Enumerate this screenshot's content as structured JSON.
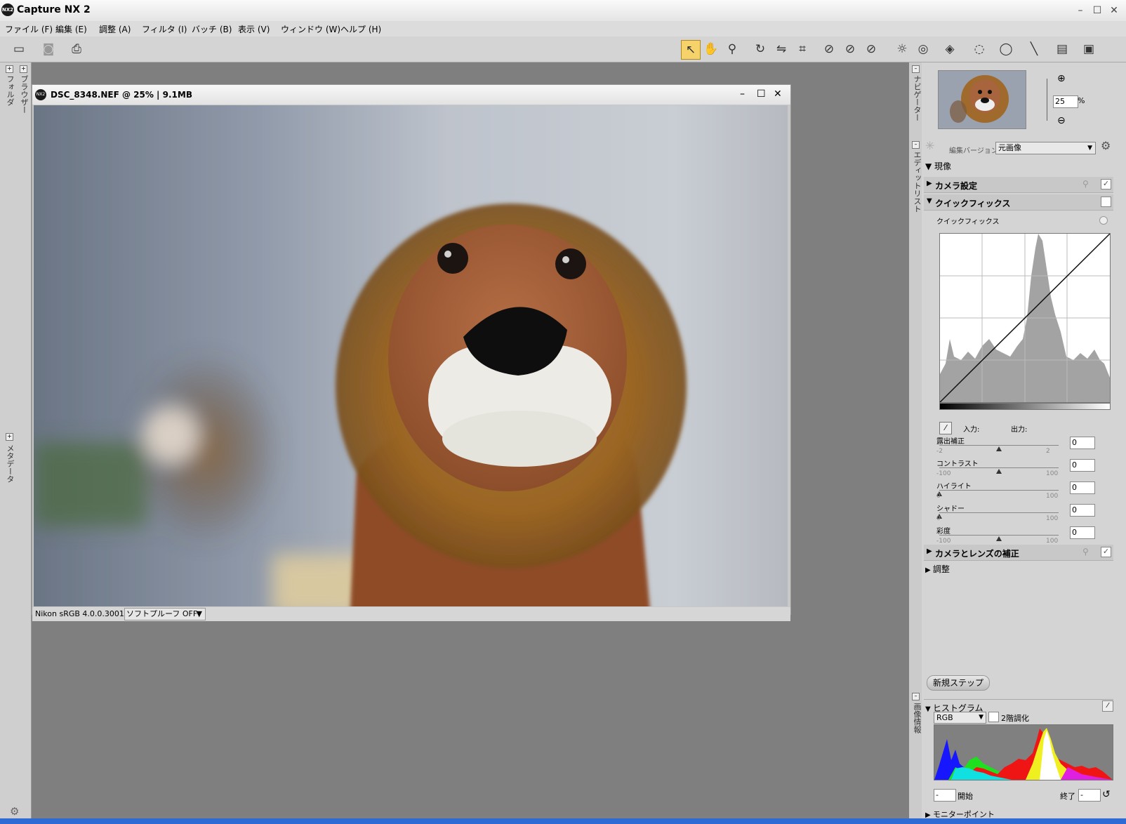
{
  "app": {
    "title": "Capture NX 2",
    "logo_text": "NX2",
    "window_buttons": [
      "–",
      "☐",
      "✕"
    ]
  },
  "menu": [
    "ファイル (F)",
    "編集 (E)",
    "調整 (A)",
    "フィルタ (I)",
    "バッチ (B)",
    "表示 (V)",
    "ウィンドウ (W)",
    "ヘルプ (H)"
  ],
  "left_panel": {
    "folder_tab": "フォルダ",
    "browser_tab": "ブラウザー",
    "metadata_tab": "メタデータ"
  },
  "image_window": {
    "title": "DSC_8348.NEF @ 25% | 9.1MB",
    "color_profile": "Nikon sRGB 4.0.0.3001",
    "soft_proof": "ソフトプルーフ OFF"
  },
  "navigator": {
    "tab_label": "ナビゲーター",
    "zoom_value": "25",
    "zoom_unit": "%"
  },
  "edit_list": {
    "tab_label": "エディットリスト",
    "version_label": "編集バージョン",
    "version_value": "元画像",
    "develop_label": "現像",
    "camera_settings": "カメラ設定",
    "quick_fix_header": "クイックフィックス",
    "quick_fix_item": "クイックフィックス",
    "input_label": "入力:",
    "output_label": "出力:",
    "camera_lens": "カメラとレンズの補正",
    "adjust": "調整",
    "new_step": "新規ステップ",
    "sliders": [
      {
        "label": "露出補正",
        "min": "-2",
        "max": "2",
        "value": "0",
        "position": 0.5
      },
      {
        "label": "コントラスト",
        "min": "-100",
        "max": "100",
        "value": "0",
        "position": 0.5
      },
      {
        "label": "ハイライト",
        "min": "0",
        "max": "100",
        "value": "0",
        "position": 0.0
      },
      {
        "label": "シャドー",
        "min": "0",
        "max": "100",
        "value": "0",
        "position": 0.0
      },
      {
        "label": "彩度",
        "min": "-100",
        "max": "100",
        "value": "0",
        "position": 0.5
      }
    ]
  },
  "histogram": {
    "tab_label": "画像情報",
    "header": "ヒストグラム",
    "channel": "RGB",
    "gradation_label": "2階調化",
    "start_label": "開始",
    "start_value": "-",
    "end_label": "終了",
    "end_value": "-",
    "monitor_point": "モニターポイント"
  },
  "colors": {
    "accent_tool": "#f5d36a",
    "workspace": "#808080",
    "taskbar": "#2f6bd4"
  }
}
